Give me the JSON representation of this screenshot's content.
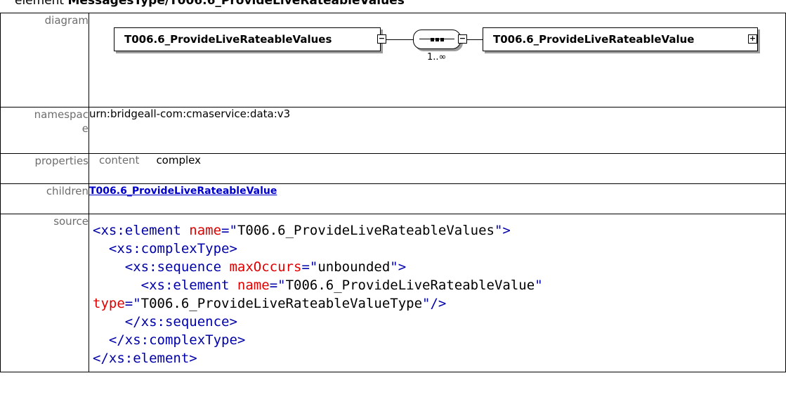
{
  "heading": {
    "prefix": "element ",
    "name": "MessagesType/T006.6_ProvideLiveRateableValues"
  },
  "rows": {
    "diagram": {
      "label": "diagram",
      "element_box": "T006.6_ProvideLiveRateableValues",
      "child_box": "T006.6_ProvideLiveRateableValue",
      "multiplicity": "1..∞",
      "collapse_symbol": "−",
      "expand_symbol": "+"
    },
    "namespace": {
      "label_line1": "namespac",
      "label_line2": "e",
      "value": "urn:bridgeall-com:cmaservice:data:v3"
    },
    "properties": {
      "label": "properties",
      "key": "content",
      "value": "complex"
    },
    "children": {
      "label": "children",
      "link": "T006.6_ProvideLiveRateableValue"
    },
    "source": {
      "label": "source",
      "lines": [
        {
          "indent": "",
          "open": "<xs:element ",
          "attr1": "name",
          "eq1": "=\"",
          "val1": "T006.6_ProvideLiveRateableValues",
          "close1": "\">"
        },
        {
          "indent": "  ",
          "open": "<xs:complexType>"
        },
        {
          "indent": "    ",
          "open": "<xs:sequence ",
          "attr1": "maxOccurs",
          "eq1": "=\"",
          "val1": "unbounded",
          "close1": "\">"
        },
        {
          "indent": "      ",
          "open": "<xs:element ",
          "attr1": "name",
          "eq1": "=\"",
          "val1": "T006.6_ProvideLiveRateableValue",
          "close1": "\""
        },
        {
          "indent": "",
          "attr2": "type",
          "eq2": "=\"",
          "val2": "T006.6_ProvideLiveRateableValueType",
          "close2": "\"/>"
        },
        {
          "indent": "    ",
          "open": "</xs:sequence>"
        },
        {
          "indent": "  ",
          "open": "</xs:complexType>"
        },
        {
          "indent": "",
          "open": "</xs:element>"
        }
      ]
    }
  }
}
